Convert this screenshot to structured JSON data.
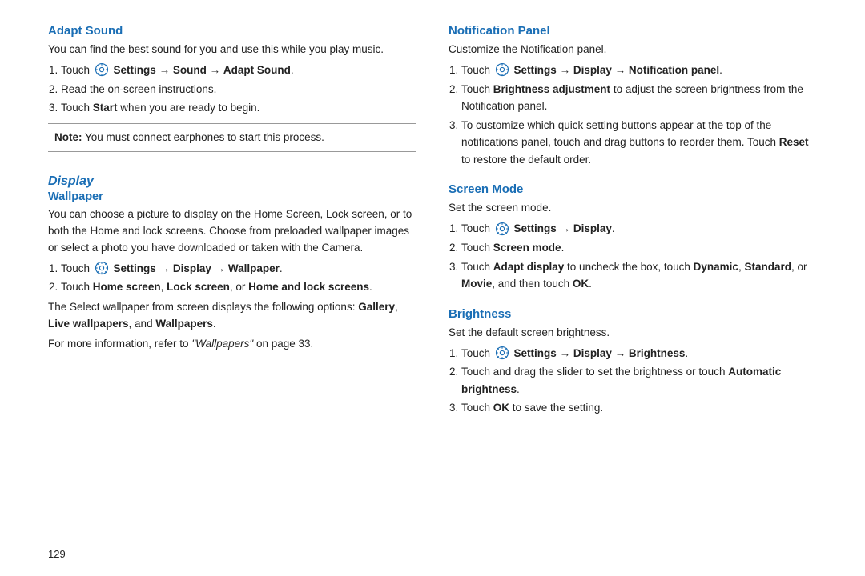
{
  "page": {
    "page_number": "129",
    "left_column": {
      "adapt_sound": {
        "title": "Adapt Sound",
        "body1": "You can find the best sound for you and use this while you play music.",
        "steps": [
          {
            "html": "Touch <icon/> <b>Settings</b> → <b>Sound</b> → <b>Adapt Sound</b>."
          },
          {
            "html": "Read the on-screen instructions."
          },
          {
            "html": "Touch <b>Start</b> when you are ready to begin."
          }
        ],
        "note": "<b>Note:</b> You must connect earphones to start this process."
      },
      "display": {
        "title": "Display",
        "wallpaper": {
          "title": "Wallpaper",
          "body": "You can choose a picture to display on the Home Screen, Lock screen, or to both the Home and lock screens. Choose from preloaded wallpaper images or select a photo you have downloaded or taken with the Camera.",
          "steps": [
            {
              "html": "Touch <icon/> <b>Settings</b> → <b>Display</b> → <b>Wallpaper</b>."
            },
            {
              "html": "Touch <b>Home screen</b>, <b>Lock screen</b>, or <b>Home and lock screens</b>."
            }
          ],
          "body2": "The Select wallpaper from screen displays the following options: <b>Gallery</b>, <b>Live wallpapers</b>, and <b>Wallpapers</b>.",
          "footer": "For more information, refer to <i>\"Wallpapers\"</i> on page 33."
        }
      }
    },
    "right_column": {
      "notification_panel": {
        "title": "Notification Panel",
        "body": "Customize the Notification panel.",
        "steps": [
          {
            "html": "Touch <icon/> <b>Settings</b> → <b>Display</b> → <b>Notification panel</b>."
          },
          {
            "html": "Touch <b>Brightness adjustment</b> to adjust the screen brightness from the Notification panel."
          },
          {
            "html": "To customize which quick setting buttons appear at the top of the notifications panel, touch and drag buttons to reorder them. Touch <b>Reset</b> to restore the default order."
          }
        ]
      },
      "screen_mode": {
        "title": "Screen Mode",
        "body": "Set the screen mode.",
        "steps": [
          {
            "html": "Touch <icon/> <b>Settings</b> → <b>Display</b>."
          },
          {
            "html": "Touch <b>Screen mode</b>."
          },
          {
            "html": "Touch <b>Adapt display</b> to uncheck the box, touch <b>Dynamic</b>, <b>Standard</b>, or <b>Movie</b>, and then touch <b>OK</b>."
          }
        ]
      },
      "brightness": {
        "title": "Brightness",
        "body": "Set the default screen brightness.",
        "steps": [
          {
            "html": "Touch <icon/> <b>Settings</b> → <b>Display</b> → <b>Brightness</b>."
          },
          {
            "html": "Touch and drag the slider to set the brightness or touch <b>Automatic brightness</b>."
          },
          {
            "html": "Touch <b>OK</b> to save the setting."
          }
        ]
      }
    }
  }
}
